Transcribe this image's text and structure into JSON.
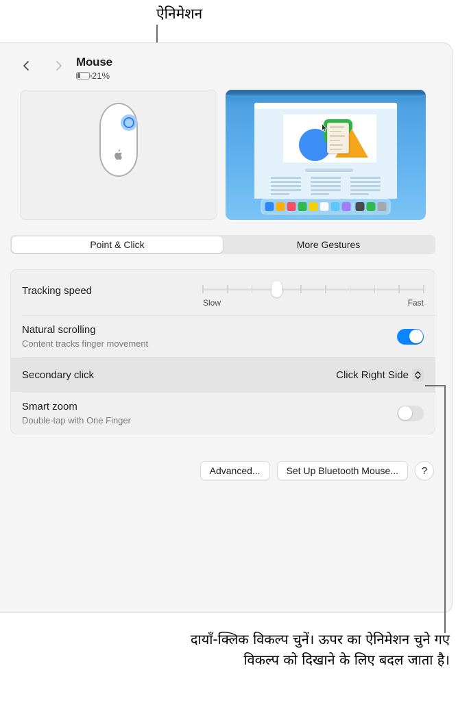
{
  "callouts": {
    "top_label": "ऐनिमेशन",
    "bottom_text": "दायाँ-क्लिक विकल्प चुनें। ऊपर का ऐनिमेशन चुने गए विकल्प को दिखाने के लिए बदल जाता है।"
  },
  "toolbar": {
    "back_icon": "chevron-left-icon",
    "forward_icon": "chevron-right-icon",
    "title": "Mouse",
    "battery_icon": "battery-icon",
    "battery_percent": "21%",
    "battery_level": 21
  },
  "preview": {
    "mouse": {
      "name": "magic-mouse-illustration",
      "click_zone": "right-side-highlight",
      "logo": "apple-logo-icon"
    },
    "animation": {
      "name": "secondary-click-animation",
      "cursor": "arrow-cursor-icon",
      "context_menu_lines": 5,
      "text_columns": 3,
      "text_lines_per_column": 5,
      "shapes": [
        "circle",
        "rounded-square",
        "triangle"
      ],
      "shape_colors": [
        "#3d8ef5",
        "#30b64a",
        "#f5a51a"
      ],
      "dock_swatches": [
        "#2f86f5",
        "#fbb00b",
        "#f74f63",
        "#2fba4b",
        "#f5d000",
        "#fcfcfc",
        "#5ec8f5",
        "#a27df5",
        "#4b4b4b",
        "#2fba4b",
        "#a8a8a8"
      ],
      "dock_separator_after_index": 7,
      "background_top": "#3a8fd0",
      "background_bottom": "#7cc4f6"
    }
  },
  "tabs": [
    {
      "label": "Point & Click",
      "selected": true
    },
    {
      "label": "More Gestures",
      "selected": false
    }
  ],
  "settings": {
    "tracking": {
      "title": "Tracking speed",
      "slow_label": "Slow",
      "fast_label": "Fast",
      "ticks": 10,
      "value_index": 3
    },
    "natural_scrolling": {
      "title": "Natural scrolling",
      "subtitle": "Content tracks finger movement",
      "state": "on"
    },
    "secondary_click": {
      "title": "Secondary click",
      "value": "Click Right Side",
      "chevron_icon": "chevron-up-down-icon",
      "highlighted": true
    },
    "smart_zoom": {
      "title": "Smart zoom",
      "subtitle": "Double-tap with One Finger",
      "state": "off"
    }
  },
  "buttons": {
    "advanced": "Advanced...",
    "set_up_bluetooth": "Set Up Bluetooth Mouse...",
    "help": "?"
  },
  "colors": {
    "accent": "#0a84ff",
    "window_bg": "#f5f5f5",
    "group_bg": "#f0f0f0",
    "highlight_row": "#e4e4e4",
    "callout_line": "#6d6d6d"
  }
}
